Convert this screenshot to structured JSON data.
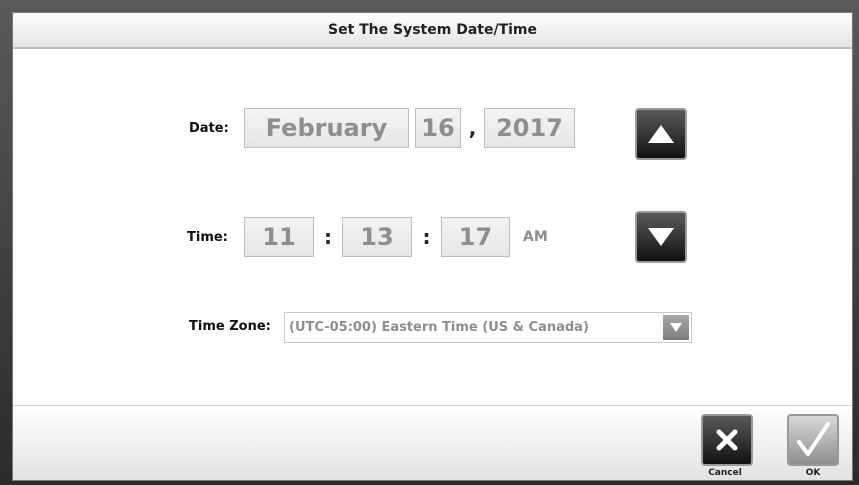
{
  "dialog": {
    "title": "Set The System Date/Time"
  },
  "date": {
    "label": "Date:",
    "month": "February",
    "day": "16",
    "separator": ",",
    "year": "2017"
  },
  "time": {
    "label": "Time:",
    "hour": "11",
    "minute": "13",
    "second": "17",
    "separator": ":",
    "meridiem": "AM"
  },
  "timezone": {
    "label": "Time Zone:",
    "value": "(UTC-05:00) Eastern Time (US & Canada)"
  },
  "controls": {
    "increment_icon": "triangle-up-icon",
    "decrement_icon": "triangle-down-icon"
  },
  "footer": {
    "cancel_label": "Cancel",
    "ok_label": "OK",
    "cancel_icon": "x-icon",
    "ok_icon": "checkmark-icon"
  }
}
